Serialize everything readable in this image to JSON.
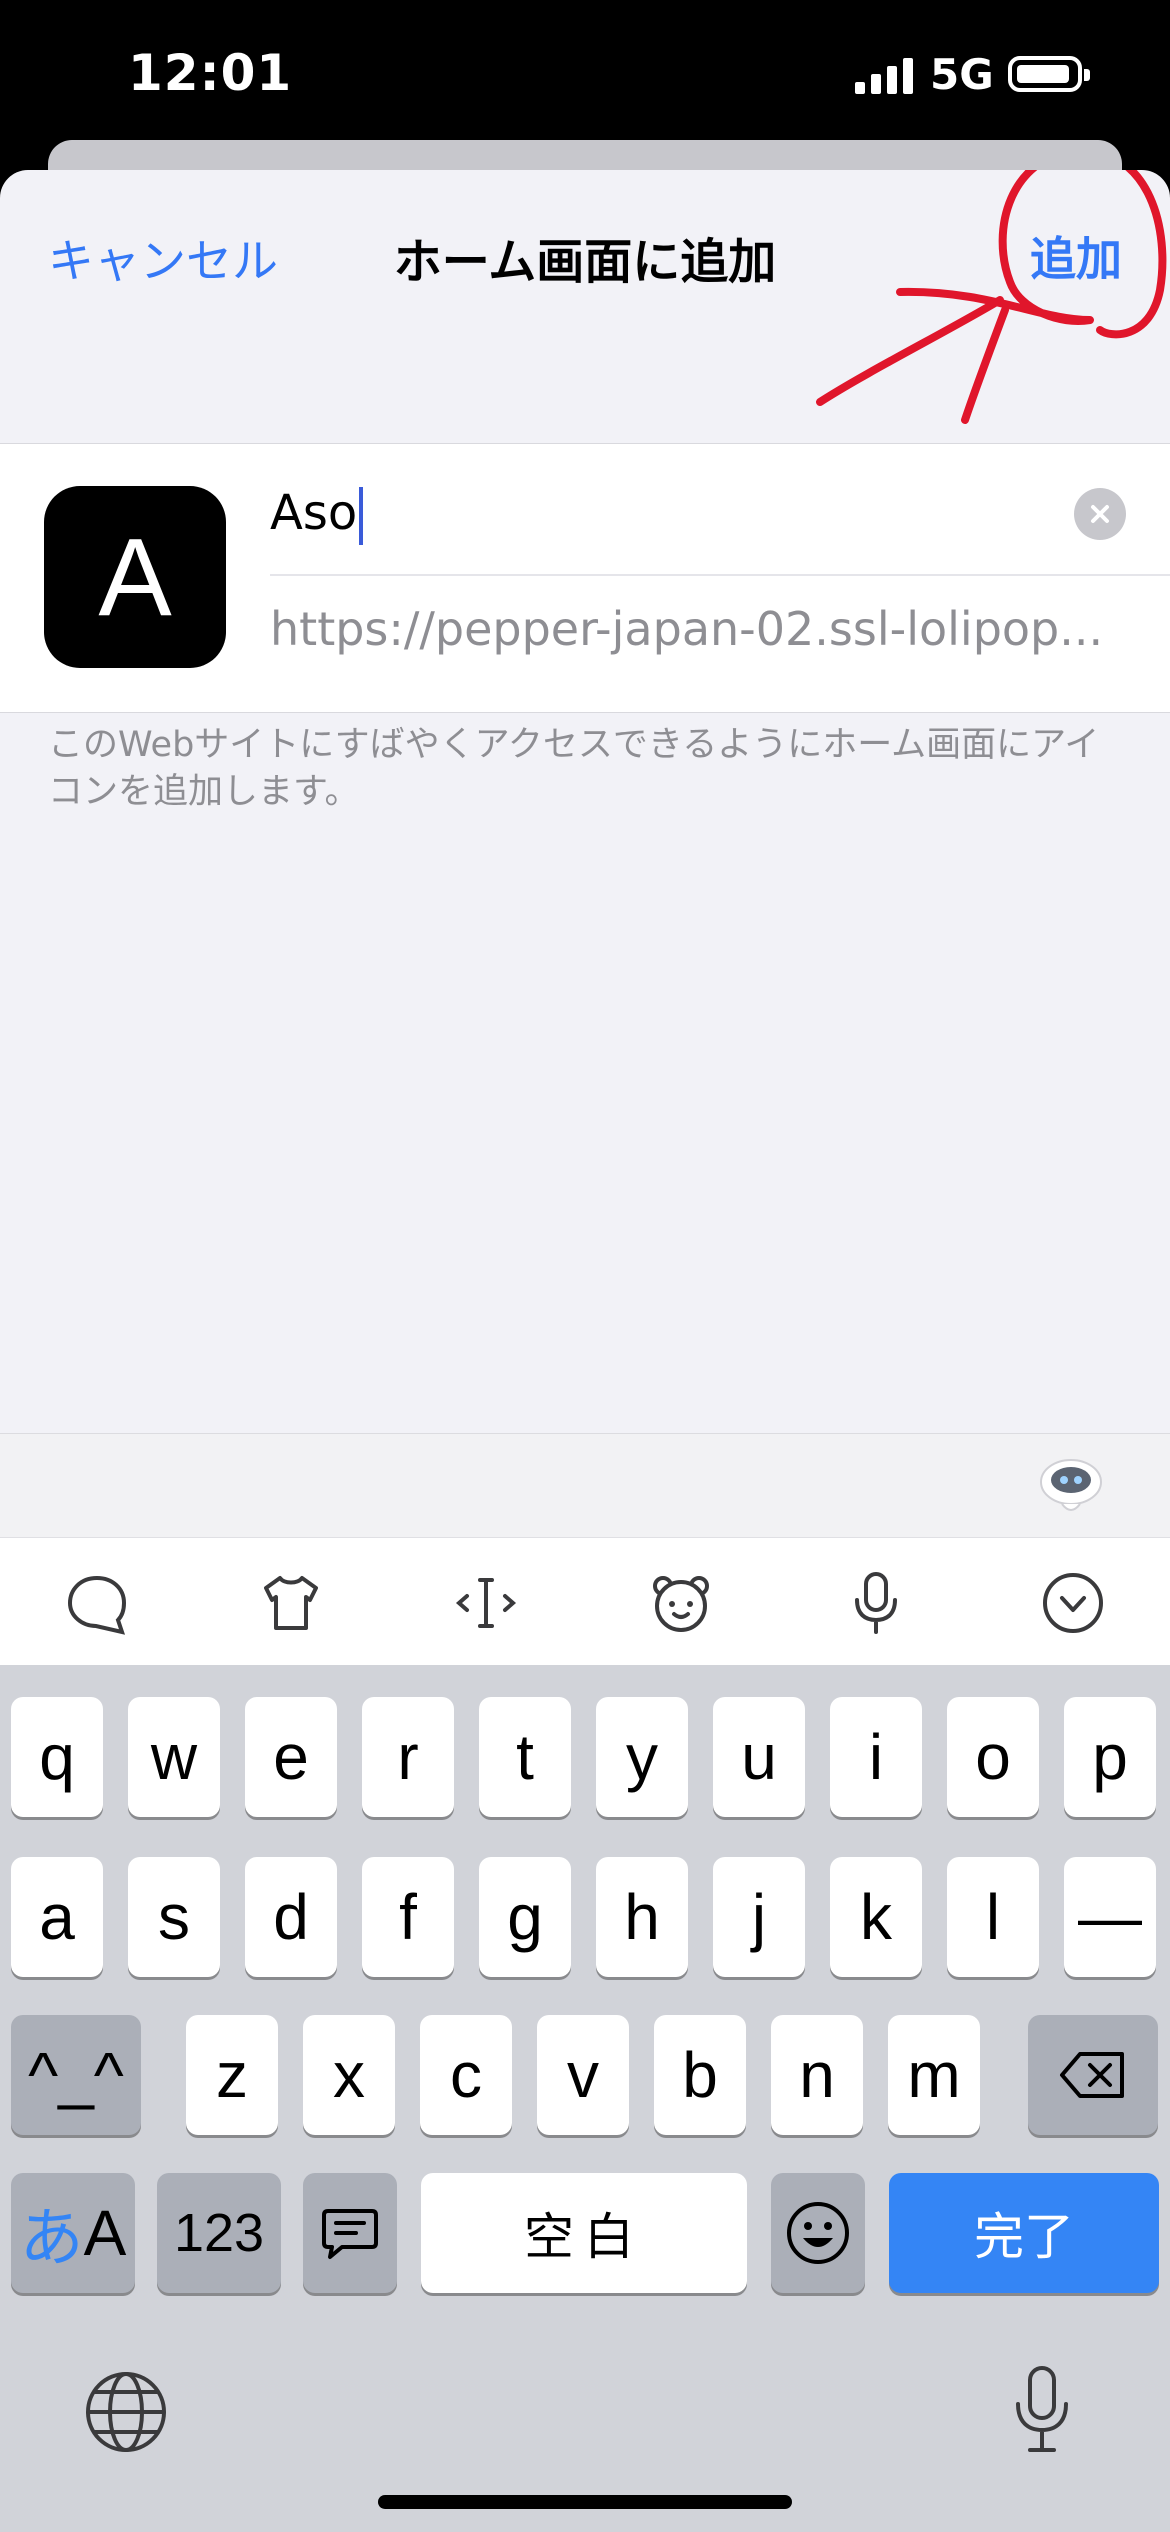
{
  "status_bar": {
    "time": "12:01",
    "network": "5G"
  },
  "nav": {
    "cancel": "キャンセル",
    "title": "ホーム画面に追加",
    "add": "追加"
  },
  "bookmark": {
    "icon_letter": "A",
    "name": "Aso",
    "url": "https://pepper-japan-02.ssl-lolipop...",
    "description": "このWebサイトにすばやくアクセスできるようにホーム画面にアイコンを追加します。"
  },
  "keyboard": {
    "row1": [
      "q",
      "w",
      "e",
      "r",
      "t",
      "y",
      "u",
      "i",
      "o",
      "p"
    ],
    "row2": [
      "a",
      "s",
      "d",
      "f",
      "g",
      "h",
      "j",
      "k",
      "l",
      "—"
    ],
    "row3": [
      "z",
      "x",
      "c",
      "v",
      "b",
      "n",
      "m"
    ],
    "emoticon_key": "^_^",
    "kana_key_a": "あ",
    "kana_key_b": "A",
    "numbers_key": "123",
    "space_key": "空白",
    "done_key": "完了"
  },
  "icons": [
    "signal-icon",
    "battery-icon",
    "clear-icon",
    "robot-icon",
    "chat-icon",
    "shirt-icon",
    "cursor-icon",
    "bear-face-icon",
    "microphone-icon",
    "chevron-down-icon",
    "delete-icon",
    "comment-icon",
    "emoji-icon",
    "globe-icon"
  ],
  "colors": {
    "accent": "#3478f6",
    "annotation": "#e0162b",
    "done_key": "#3485f5"
  }
}
